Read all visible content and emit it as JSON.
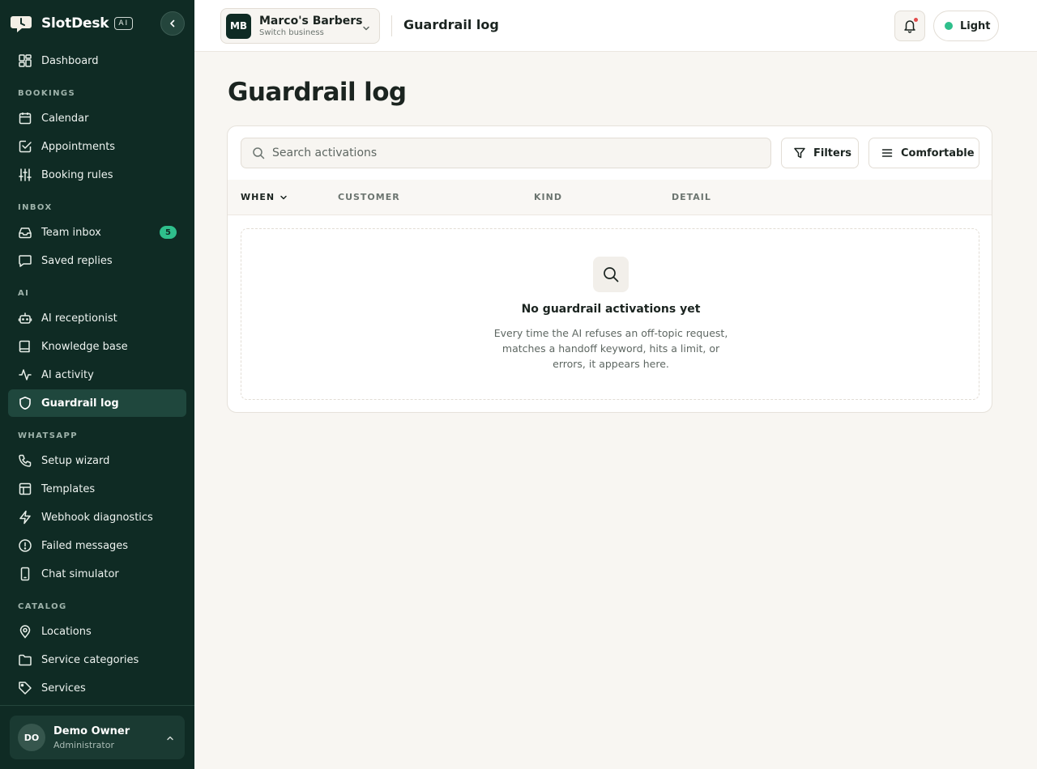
{
  "brand": {
    "name": "SlotDesk",
    "badge": "AI"
  },
  "sidebar": {
    "top_items": [
      {
        "label": "Dashboard",
        "icon": "dashboard-icon"
      }
    ],
    "sections": [
      {
        "title": "BOOKINGS",
        "items": [
          {
            "label": "Calendar",
            "icon": "calendar-icon"
          },
          {
            "label": "Appointments",
            "icon": "calendar-check-icon"
          },
          {
            "label": "Booking rules",
            "icon": "sliders-icon"
          }
        ]
      },
      {
        "title": "INBOX",
        "items": [
          {
            "label": "Team inbox",
            "icon": "inbox-icon",
            "badge": "5"
          },
          {
            "label": "Saved replies",
            "icon": "message-square-icon"
          }
        ]
      },
      {
        "title": "AI",
        "items": [
          {
            "label": "AI receptionist",
            "icon": "bot-icon"
          },
          {
            "label": "Knowledge base",
            "icon": "book-icon"
          },
          {
            "label": "AI activity",
            "icon": "activity-icon"
          },
          {
            "label": "Guardrail log",
            "icon": "shield-icon",
            "active": true
          }
        ]
      },
      {
        "title": "WHATSAPP",
        "items": [
          {
            "label": "Setup wizard",
            "icon": "phone-icon"
          },
          {
            "label": "Templates",
            "icon": "template-icon"
          },
          {
            "label": "Webhook diagnostics",
            "icon": "zap-icon"
          },
          {
            "label": "Failed messages",
            "icon": "alert-circle-icon"
          },
          {
            "label": "Chat simulator",
            "icon": "smartphone-icon"
          }
        ]
      },
      {
        "title": "CATALOG",
        "items": [
          {
            "label": "Locations",
            "icon": "map-pin-icon"
          },
          {
            "label": "Service categories",
            "icon": "folder-icon"
          },
          {
            "label": "Services",
            "icon": "tag-icon"
          }
        ]
      }
    ]
  },
  "user": {
    "initials": "DO",
    "name": "Demo Owner",
    "role": "Administrator"
  },
  "header": {
    "business": {
      "initials": "MB",
      "name": "Marco's Barbers",
      "subtitle": "Switch business"
    },
    "title": "Guardrail log",
    "theme_label": "Light"
  },
  "main": {
    "page_title": "Guardrail log",
    "search_placeholder": "Search activations",
    "filters_label": "Filters",
    "density_label": "Comfortable",
    "columns": [
      "WHEN",
      "CUSTOMER",
      "KIND",
      "DETAIL"
    ],
    "empty": {
      "title": "No guardrail activations yet",
      "description": "Every time the AI refuses an off-topic request, matches a handoff keyword, hits a limit, or errors, it appears here."
    }
  },
  "colors": {
    "sidebar_bg": "#0f2b24",
    "accent": "#2fbf8c",
    "page_bg": "#f8f6f2"
  }
}
